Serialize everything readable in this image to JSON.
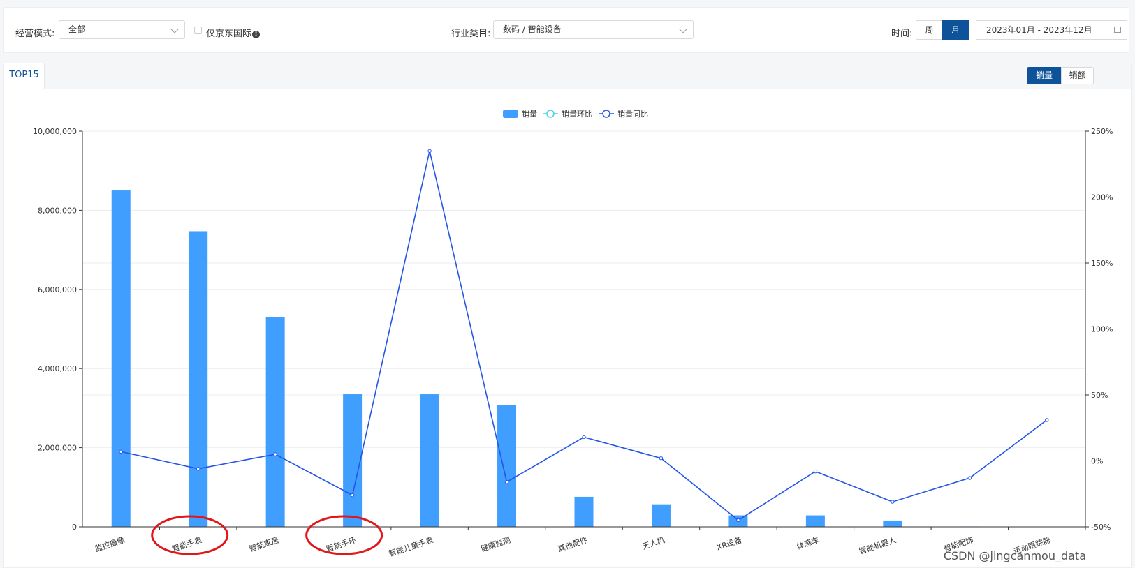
{
  "filters": {
    "mode_label": "经营模式:",
    "mode_value": "全部",
    "jd_intl_label": "仅京东国际",
    "industry_label": "行业类目:",
    "industry_value": "数码 / 智能设备",
    "time_label": "时间:",
    "week_label": "周",
    "month_label": "月",
    "date_range": "2023年01月 - 2023年12月"
  },
  "panel": {
    "tab_label": "TOP15",
    "metric_volume": "销量",
    "metric_amount": "销额"
  },
  "chart_data": {
    "type": "bar",
    "legend": [
      "销量",
      "销量环比",
      "销量同比"
    ],
    "categories": [
      "监控摄像",
      "智能手表",
      "智能家居",
      "智能手环",
      "智能儿童手表",
      "健康监测",
      "其他配件",
      "无人机",
      "XR设备",
      "体感车",
      "智能机器人",
      "智能配饰",
      "运动跟踪器"
    ],
    "series": [
      {
        "name": "销量",
        "type": "bar",
        "axis": "left",
        "values": [
          8500000,
          7470000,
          5300000,
          3350000,
          3350000,
          3070000,
          760000,
          570000,
          290000,
          290000,
          160000,
          10000,
          5000
        ]
      },
      {
        "name": "销量同比",
        "type": "line",
        "axis": "right",
        "values": [
          7,
          -6,
          5,
          -26,
          235,
          -16,
          18,
          2,
          -45,
          -8,
          -31,
          -13,
          31
        ]
      },
      {
        "name": "销量环比",
        "type": "line",
        "axis": "right",
        "values": []
      }
    ],
    "y_left": {
      "min": 0,
      "max": 10000000,
      "ticks": [
        "0",
        "2,000,000",
        "4,000,000",
        "6,000,000",
        "8,000,000",
        "10,000,000"
      ]
    },
    "y_right": {
      "min": -50,
      "max": 250,
      "ticks": [
        "-50%",
        "0%",
        "50%",
        "100%",
        "150%",
        "200%",
        "250%"
      ]
    },
    "legend_position": "top-center",
    "grid": true,
    "colors": {
      "bar": "#409eff",
      "yoy_line": "#2455e8",
      "mom_line": "#3fd4e8"
    }
  },
  "watermark": "CSDN @jingcanmou_data"
}
